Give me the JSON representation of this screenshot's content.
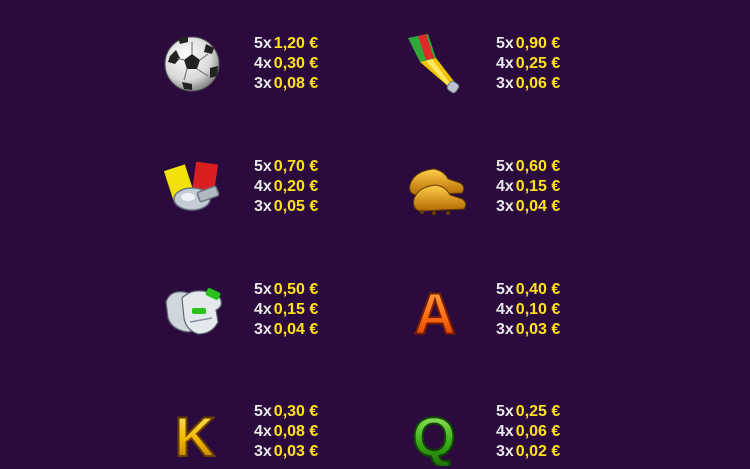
{
  "colors": {
    "background": "#2b0b3d",
    "multiplier_text": "#e8e8e8",
    "amount_text": "#ffe21a"
  },
  "symbols": [
    {
      "id": "soccer-ball",
      "icon": "soccer-ball-icon",
      "payouts": [
        {
          "count": "5x",
          "amount": "1,20 €"
        },
        {
          "count": "4x",
          "amount": "0,30 €"
        },
        {
          "count": "3x",
          "amount": "0,08 €"
        }
      ]
    },
    {
      "id": "vuvuzela",
      "icon": "vuvuzela-icon",
      "payouts": [
        {
          "count": "5x",
          "amount": "0,90 €"
        },
        {
          "count": "4x",
          "amount": "0,25 €"
        },
        {
          "count": "3x",
          "amount": "0,06 €"
        }
      ]
    },
    {
      "id": "cards-whistle",
      "icon": "cards-whistle-icon",
      "payouts": [
        {
          "count": "5x",
          "amount": "0,70 €"
        },
        {
          "count": "4x",
          "amount": "0,20 €"
        },
        {
          "count": "3x",
          "amount": "0,05 €"
        }
      ]
    },
    {
      "id": "boots",
      "icon": "football-boots-icon",
      "payouts": [
        {
          "count": "5x",
          "amount": "0,60 €"
        },
        {
          "count": "4x",
          "amount": "0,15 €"
        },
        {
          "count": "3x",
          "amount": "0,04 €"
        }
      ]
    },
    {
      "id": "gloves",
      "icon": "goalkeeper-gloves-icon",
      "payouts": [
        {
          "count": "5x",
          "amount": "0,50 €"
        },
        {
          "count": "4x",
          "amount": "0,15 €"
        },
        {
          "count": "3x",
          "amount": "0,04 €"
        }
      ]
    },
    {
      "id": "letter-a",
      "icon": "letter-a-icon",
      "letter": "A",
      "payouts": [
        {
          "count": "5x",
          "amount": "0,40 €"
        },
        {
          "count": "4x",
          "amount": "0,10 €"
        },
        {
          "count": "3x",
          "amount": "0,03 €"
        }
      ]
    },
    {
      "id": "letter-k",
      "icon": "letter-k-icon",
      "letter": "K",
      "payouts": [
        {
          "count": "5x",
          "amount": "0,30 €"
        },
        {
          "count": "4x",
          "amount": "0,08 €"
        },
        {
          "count": "3x",
          "amount": "0,03 €"
        }
      ]
    },
    {
      "id": "letter-q",
      "icon": "letter-q-icon",
      "letter": "Q",
      "payouts": [
        {
          "count": "5x",
          "amount": "0,25 €"
        },
        {
          "count": "4x",
          "amount": "0,06 €"
        },
        {
          "count": "3x",
          "amount": "0,02 €"
        }
      ]
    }
  ]
}
